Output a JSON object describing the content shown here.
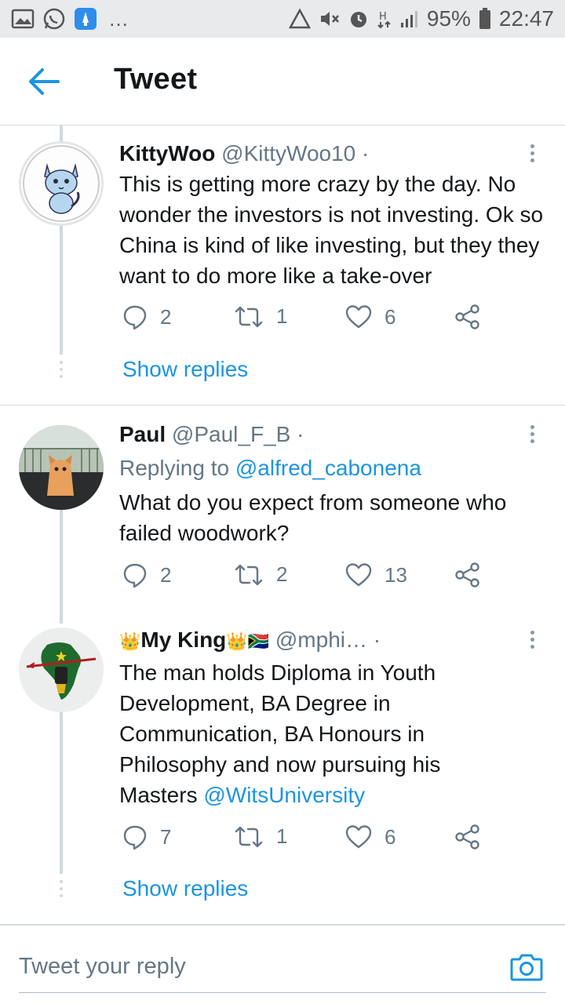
{
  "status_bar": {
    "battery": "95%",
    "time": "22:47",
    "more": "…"
  },
  "header": {
    "title": "Tweet"
  },
  "tweets": [
    {
      "name": "KittyWoo",
      "handle": "@KittyWoo10",
      "separator": "·",
      "text": "This is getting more crazy by the day. No wonder the investors is not investing. Ok so China is kind of like investing, but they they want to do more like a take-over",
      "replies": "2",
      "retweets": "1",
      "likes": "6",
      "show_replies": "Show replies"
    },
    {
      "name": "Paul",
      "handle": "@Paul_F_B",
      "separator": "·",
      "replying_prefix": "Replying to ",
      "replying_to": "@alfred_cabonena",
      "text": "What do you expect from someone who failed woodwork?",
      "replies": "2",
      "retweets": "2",
      "likes": "13"
    },
    {
      "name_prefix": "👑",
      "name": "My King",
      "name_suffix": "👑🇿🇦",
      "handle": "@mphi…",
      "separator": "·",
      "text": "The man holds Diploma in Youth Development,  BA Degree in Communication, BA Honours in Philosophy and now pursuing his Masters ",
      "mention": "@WitsUniversity",
      "replies": "7",
      "retweets": "1",
      "likes": "6",
      "show_replies": "Show replies"
    }
  ],
  "composer": {
    "placeholder": "Tweet your reply"
  },
  "colors": {
    "accent": "#1b95e0",
    "muted": "#657786",
    "divider": "#d6dbe0"
  },
  "icons": [
    "back-arrow-icon",
    "reply-icon",
    "retweet-icon",
    "like-icon",
    "share-icon",
    "more-vertical-icon",
    "camera-icon"
  ]
}
